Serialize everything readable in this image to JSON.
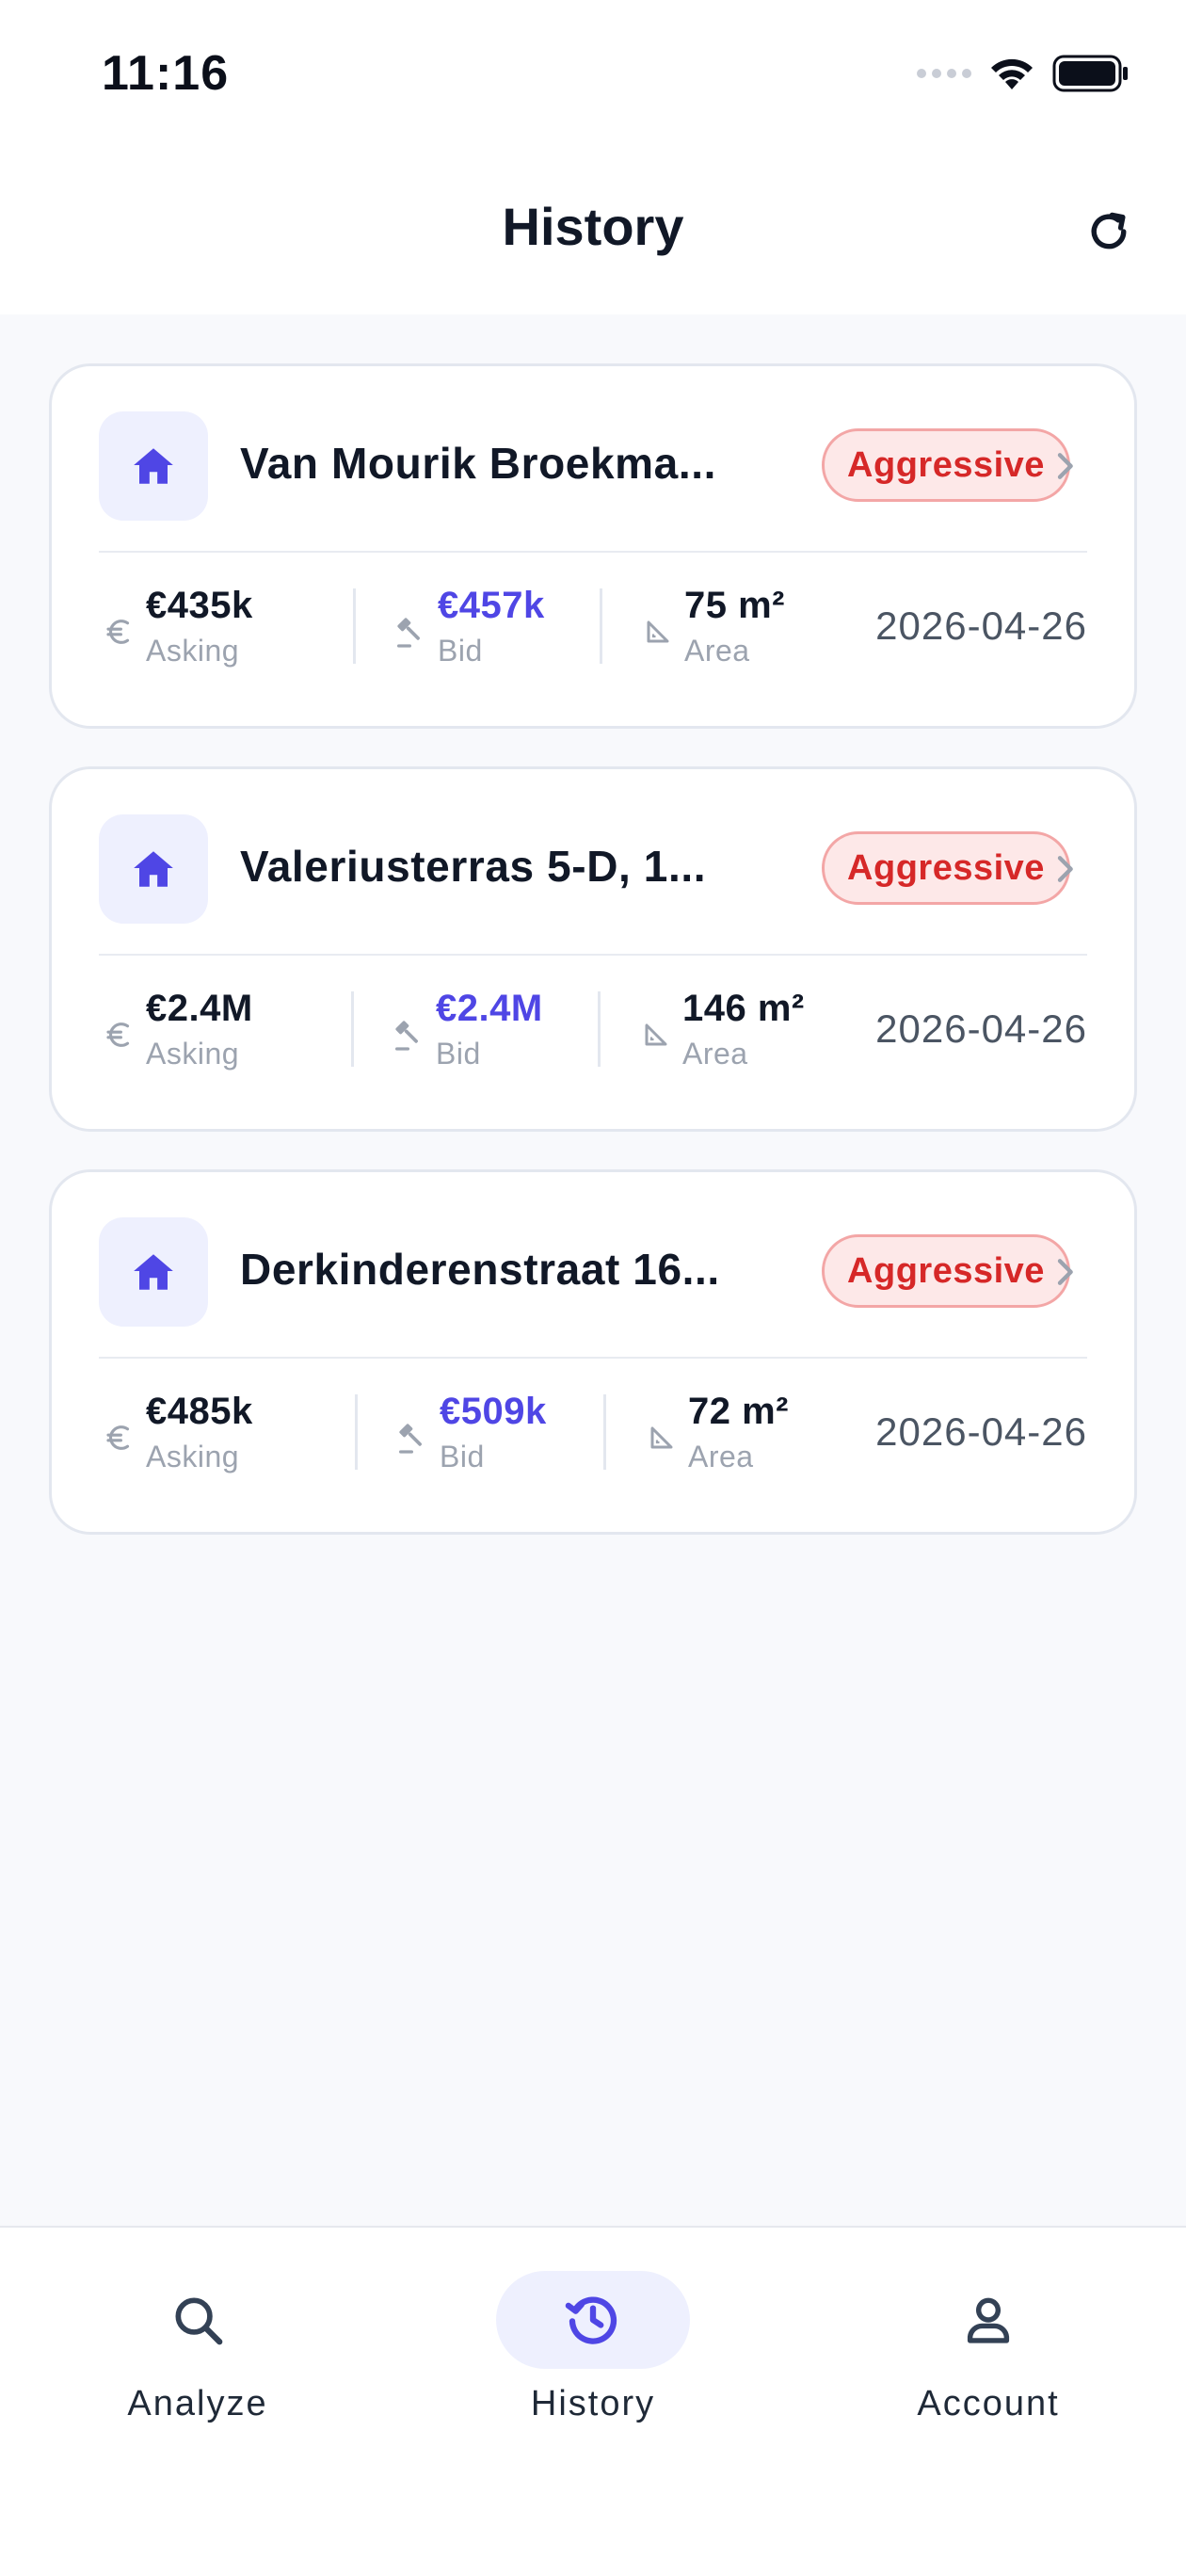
{
  "status_bar": {
    "time": "11:16",
    "icons": [
      "signal-icon",
      "wifi-icon",
      "battery-icon"
    ]
  },
  "header": {
    "title": "History",
    "refresh_icon": "refresh-icon"
  },
  "labels": {
    "asking": "Asking",
    "bid": "Bid",
    "area": "Area"
  },
  "colors": {
    "accent": "#4F46E5",
    "badge_text": "#D62828",
    "badge_bg": "#FDE8E8"
  },
  "history": [
    {
      "title": "Van Mourik Broekma...",
      "badge": "Aggressive",
      "asking": "€435k",
      "bid": "€457k",
      "area": "75 m²",
      "date": "2026-04-26"
    },
    {
      "title": "Valeriusterras 5-D, 1...",
      "badge": "Aggressive",
      "asking": "€2.4M",
      "bid": "€2.4M",
      "area": "146 m²",
      "date": "2026-04-26"
    },
    {
      "title": "Derkinderenstraat 16...",
      "badge": "Aggressive",
      "asking": "€485k",
      "bid": "€509k",
      "area": "72 m²",
      "date": "2026-04-26"
    }
  ],
  "nav": {
    "items": [
      {
        "label": "Analyze",
        "icon": "search-icon"
      },
      {
        "label": "History",
        "icon": "history-icon",
        "active": true
      },
      {
        "label": "Account",
        "icon": "user-icon"
      }
    ]
  }
}
